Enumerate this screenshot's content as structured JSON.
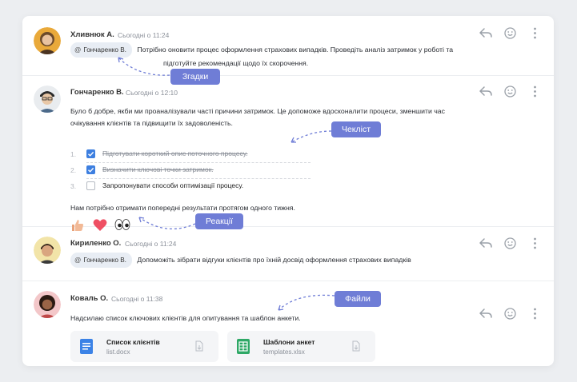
{
  "messages": [
    {
      "author": "Хливнюк А.",
      "time": "Сьогодні о 11:24",
      "mention": "Гончаренко В.",
      "text_line1": "Потрібно оновити процес оформлення страхових випадків. Проведіть аналіз затримок у роботі та",
      "text_line2": "підготуйте рекомендації щодо їх скорочення."
    },
    {
      "author": "Гончаренко В.",
      "time": "Сьогодні о 12:10",
      "text_line1": "Було б добре, якби ми проаналізували часті причини затримок. Це допоможе вдосконалити процеси, зменшити час",
      "text_line2": "очікування клієнтів та підвищити їх задоволеність.",
      "checklist": [
        {
          "num": "1.",
          "text": "Підготувати короткий опис поточного процесу.",
          "done": true
        },
        {
          "num": "2.",
          "text": "Визначити ключові точки затримок.",
          "done": true
        },
        {
          "num": "3.",
          "text": "Запропонувати способи оптимізації процесу.",
          "done": false
        }
      ],
      "text_after": "Нам потрібно отримати попередні результати протягом одного тижня.",
      "reactions": [
        "👍",
        "❤",
        "👀"
      ]
    },
    {
      "author": "Кириленко О.",
      "time": "Сьогодні о 11:24",
      "mention": "Гончаренко В.",
      "text_line1": "Допоможіть зібрати відгуки клієнтів про їхній досвід оформлення страхових випадків"
    },
    {
      "author": "Коваль О.",
      "time": "Сьогодні о 11:38",
      "text_line1": "Надсилаю список ключових клієнтів для опитування та шаблон анкети.",
      "files": [
        {
          "name": "Список клієнтів",
          "file": "list.docx",
          "icon": "doc-icon",
          "color": "#3b82e6"
        },
        {
          "name": "Шаблони анкет",
          "file": "templates.xlsx",
          "icon": "sheet-icon",
          "color": "#2ea866"
        }
      ]
    }
  ],
  "annotations": {
    "mentions": "Згадки",
    "checklist": "Чекліст",
    "reactions": "Реакції",
    "files": "Файли"
  },
  "colors": {
    "accent_tag": "#6f7dd6",
    "checkbox": "#3d7fe0",
    "background": "#eceef1"
  }
}
